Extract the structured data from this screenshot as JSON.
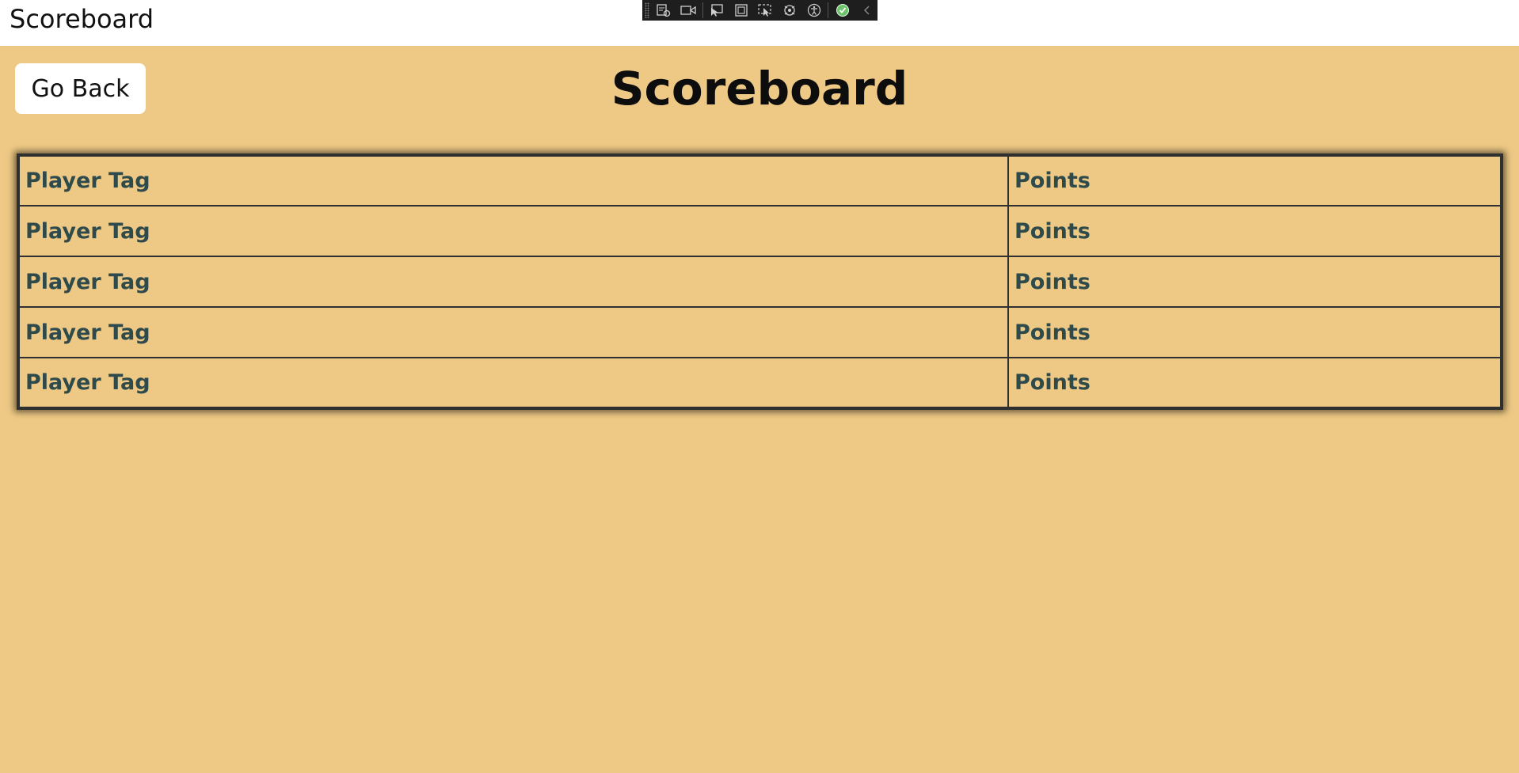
{
  "window": {
    "title": "Scoreboard"
  },
  "debug_toolbar": {
    "buttons": [
      {
        "icon": "live-visual-tree-icon"
      },
      {
        "icon": "video-camera-icon"
      },
      {
        "icon": "select-element-icon"
      },
      {
        "icon": "display-layout-adorners-icon"
      },
      {
        "icon": "track-focused-element-icon"
      },
      {
        "icon": "hot-reload-icon"
      },
      {
        "icon": "accessibility-icon"
      },
      {
        "icon": "check-circle-icon"
      },
      {
        "icon": "collapse-chevron-icon"
      }
    ]
  },
  "header": {
    "back_label": "Go Back",
    "title": "Scoreboard"
  },
  "scoreboard": {
    "rows": [
      {
        "tag": "Player Tag",
        "points": "Points"
      },
      {
        "tag": "Player Tag",
        "points": "Points"
      },
      {
        "tag": "Player Tag",
        "points": "Points"
      },
      {
        "tag": "Player Tag",
        "points": "Points"
      },
      {
        "tag": "Player Tag",
        "points": "Points"
      }
    ]
  },
  "colors": {
    "background": "#eec985",
    "cell_text": "#2e4a4a",
    "border": "#2f2f2f"
  }
}
